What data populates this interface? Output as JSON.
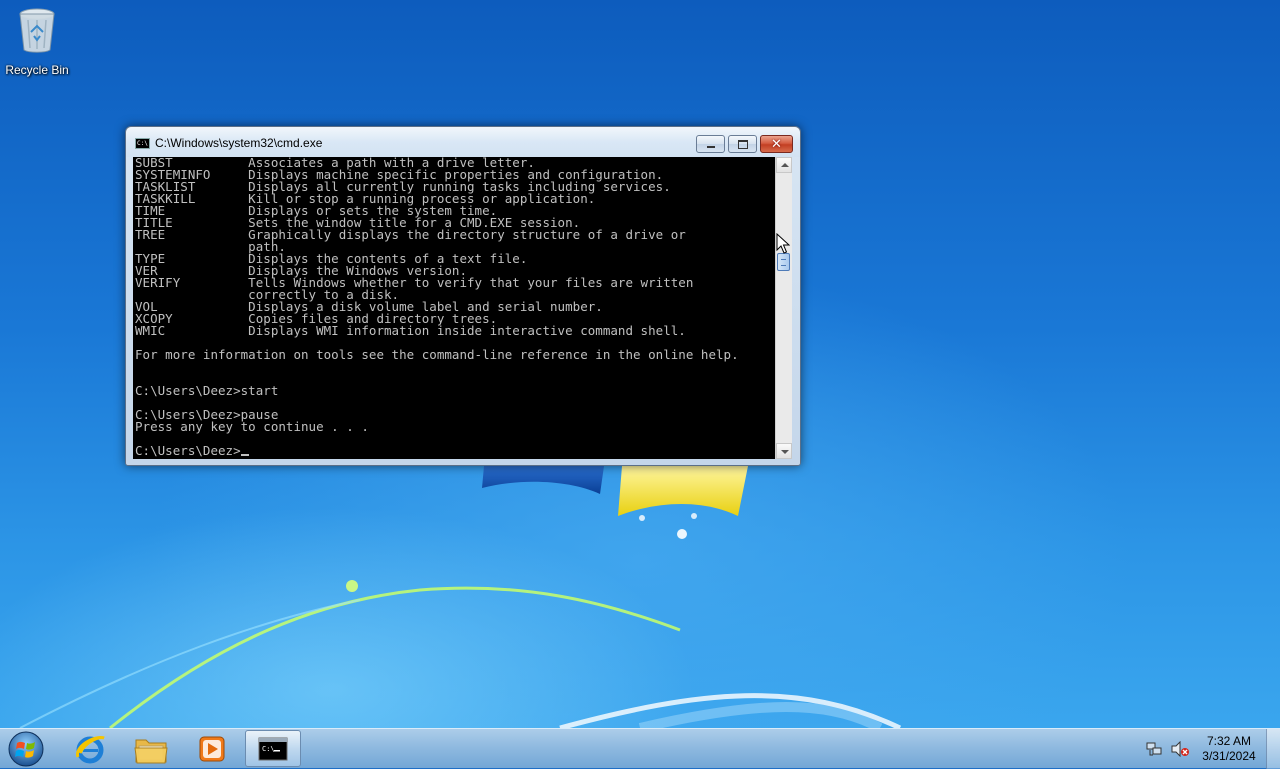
{
  "desktop": {
    "icons": [
      {
        "label": "Recycle Bin",
        "icon": "recycle-bin-icon"
      }
    ]
  },
  "cmd_window": {
    "title": "C:\\Windows\\system32\\cmd.exe",
    "icon": "cmd-icon",
    "console_lines": [
      "SUBST          Associates a path with a drive letter.",
      "SYSTEMINFO     Displays machine specific properties and configuration.",
      "TASKLIST       Displays all currently running tasks including services.",
      "TASKKILL       Kill or stop a running process or application.",
      "TIME           Displays or sets the system time.",
      "TITLE          Sets the window title for a CMD.EXE session.",
      "TREE           Graphically displays the directory structure of a drive or",
      "               path.",
      "TYPE           Displays the contents of a text file.",
      "VER            Displays the Windows version.",
      "VERIFY         Tells Windows whether to verify that your files are written",
      "               correctly to a disk.",
      "VOL            Displays a disk volume label and serial number.",
      "XCOPY          Copies files and directory trees.",
      "WMIC           Displays WMI information inside interactive command shell.",
      "",
      "For more information on tools see the command-line reference in the online help.",
      "",
      "",
      "C:\\Users\\Deez>start",
      "",
      "C:\\Users\\Deez>pause",
      "Press any key to continue . . .",
      "",
      "C:\\Users\\Deez>"
    ],
    "colors": {
      "background": "#000000",
      "text": "#c0c0c0"
    }
  },
  "taskbar": {
    "start_icon": "windows-start-orb-icon",
    "pinned": [
      {
        "name": "internet-explorer",
        "icon": "internet-explorer-icon"
      },
      {
        "name": "windows-explorer",
        "icon": "folder-icon"
      },
      {
        "name": "media-player",
        "icon": "media-player-icon"
      },
      {
        "name": "command-prompt",
        "icon": "cmd-icon",
        "active": true
      }
    ],
    "tray": {
      "network_icon": "network-icon",
      "volume_icon": "volume-muted-icon",
      "time": "7:32 AM",
      "date": "3/31/2024"
    }
  }
}
